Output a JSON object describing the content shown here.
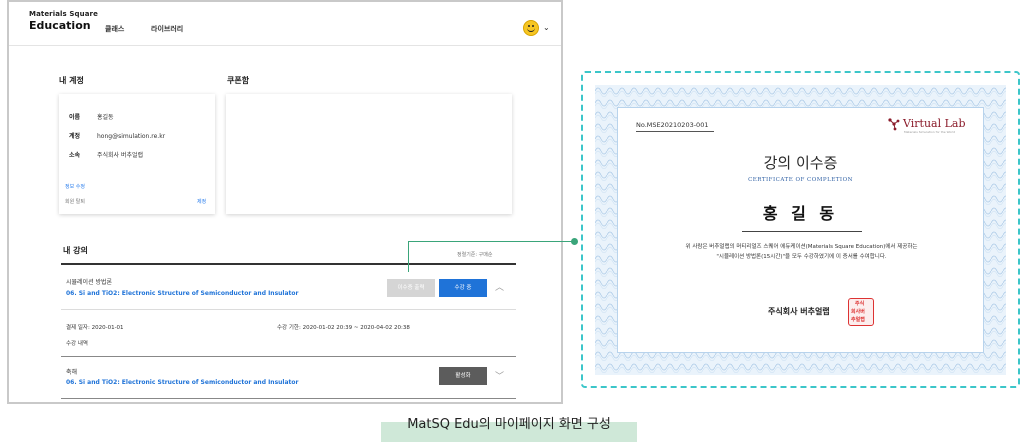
{
  "header": {
    "brand_top": "Materials Square",
    "brand_main": "Education",
    "nav": [
      "클래스",
      "라이브러리"
    ],
    "avatar_icon": "smiley-face-icon",
    "menu_icon": "chevron-down-icon"
  },
  "account": {
    "title": "내 계정",
    "rows": [
      {
        "label": "이름",
        "value": "홍길동"
      },
      {
        "label": "계정",
        "value": "hong@simulation.re.kr"
      },
      {
        "label": "소속",
        "value": "주식회사 버추얼랩"
      }
    ],
    "edit_link": "정보 수정",
    "withdraw": "회원 탈퇴",
    "withdraw_right": "제정"
  },
  "coupon": {
    "title": "쿠폰함"
  },
  "courses": {
    "title": "내 강의",
    "sort_label": "정렬기준: 구매순",
    "items": [
      {
        "category": "시뮬레이션 방법론",
        "title": "06. Si and TiO2: Electronic Structure of Semiconductor and Insulator",
        "cert_button": "이수증 출력",
        "status_button": "수강 중",
        "payment_date": "결제 일자: 2020-01-01",
        "period": "수강 기한:  2020-01-02 20:39 ~ 2020-04-02 20:38",
        "history": "수강 내역"
      },
      {
        "category": "축해",
        "title": "06. Si and TiO2: Electronic Structure of Semiconductor and Insulator",
        "status_button": "활성화"
      }
    ]
  },
  "certificate": {
    "number": "No.MSE20210203-001",
    "logo_text": "Virtual Lab",
    "logo_sub": "Materials Simulation for the World",
    "title": "강의 이수증",
    "subtitle": "CERTIFICATE OF COMPLETION",
    "name": "홍 길 동",
    "body_line1": "위 사람은 버추얼랩의 머티리얼즈 스퀘어 에듀케이션(Materials Square Education)에서 제공하는",
    "body_line2": "\"시뮬레이션 방법론(15시간)\"을 모두 수강하였기에 이 증서를 수여합니다.",
    "issuer": "주식회사 버추얼랩",
    "seal": [
      "주식",
      "회사버",
      "추얼랩"
    ]
  },
  "caption": "MatSQ Edu의 마이페이지 화면 구성",
  "colors": {
    "accent_blue": "#1f73d8",
    "teal_frame": "#3cc6c9",
    "connector_green": "#3aa57a",
    "logo_red": "#8b1c2b"
  }
}
